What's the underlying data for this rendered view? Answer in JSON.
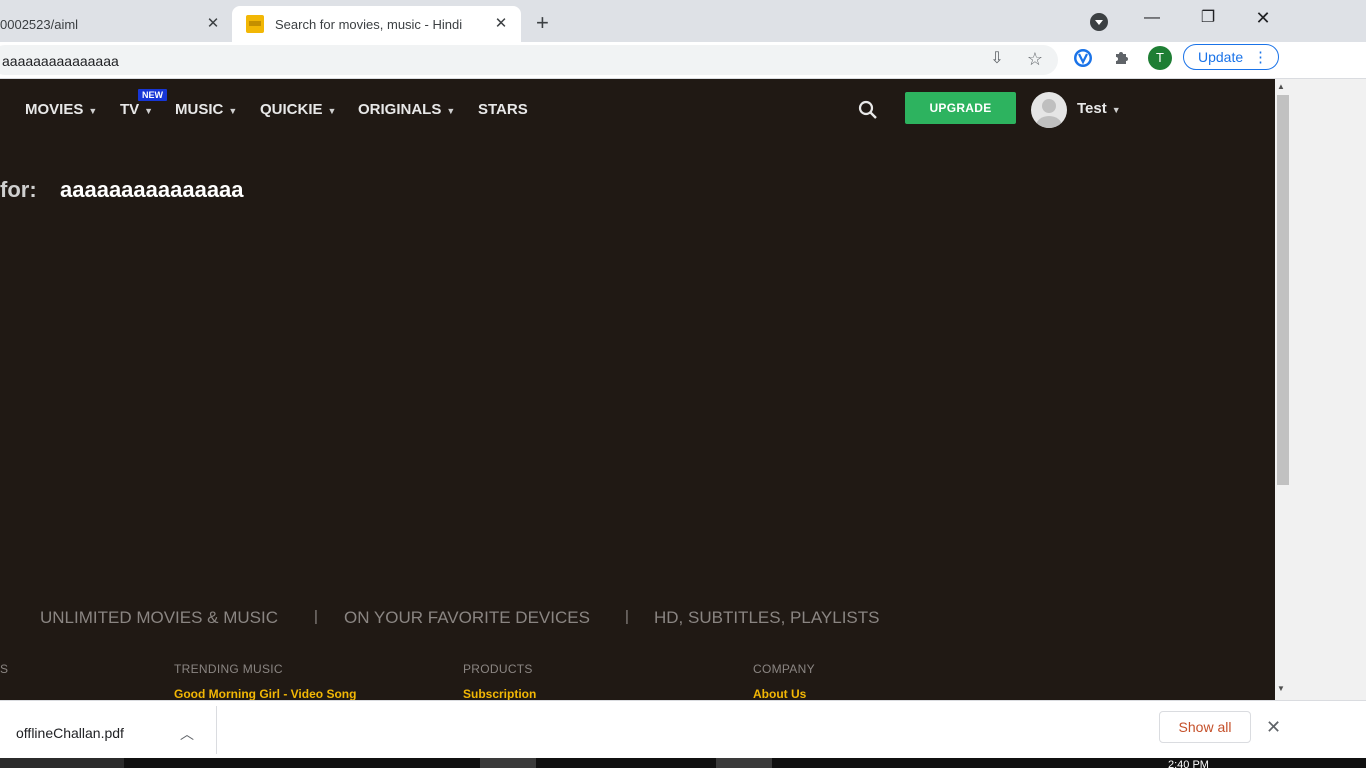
{
  "browser": {
    "tabs": [
      {
        "title": "0002523/aiml",
        "active": false
      },
      {
        "title": "Search for movies, music - Hindi",
        "active": true
      }
    ],
    "url": "aaaaaaaaaaaaaaa",
    "update_label": "Update",
    "profile_initial": "T"
  },
  "site": {
    "nav": [
      {
        "label": "MOVIES",
        "has_dropdown": true
      },
      {
        "label": "TV",
        "has_dropdown": true,
        "badge": "NEW"
      },
      {
        "label": "MUSIC",
        "has_dropdown": true
      },
      {
        "label": "QUICKIE",
        "has_dropdown": true
      },
      {
        "label": "ORIGINALS",
        "has_dropdown": true
      },
      {
        "label": "STARS",
        "has_dropdown": false
      }
    ],
    "upgrade_label": "UPGRADE",
    "user_name": "Test",
    "search_label": "for:",
    "search_query": "aaaaaaaaaaaaaaa",
    "features": [
      "UNLIMITED MOVIES & MUSIC",
      "ON YOUR FAVORITE DEVICES",
      "HD, SUBTITLES, PLAYLISTS"
    ],
    "feature_separator": "|",
    "footer": {
      "columns": [
        {
          "heading": "S",
          "link": ""
        },
        {
          "heading": "TRENDING MUSIC",
          "link": "Good Morning Girl - Video Song"
        },
        {
          "heading": "PRODUCTS",
          "link": "Subscription"
        },
        {
          "heading": "COMPANY",
          "link": "About Us"
        }
      ]
    }
  },
  "downloads": {
    "file": "offlineChallan.pdf",
    "show_all_label": "Show all"
  },
  "taskbar": {
    "clock": "2:40 PM"
  },
  "colors": {
    "page_bg": "#201914",
    "upgrade": "#2db35f",
    "link": "#f2b705",
    "badge": "#1736d6"
  }
}
